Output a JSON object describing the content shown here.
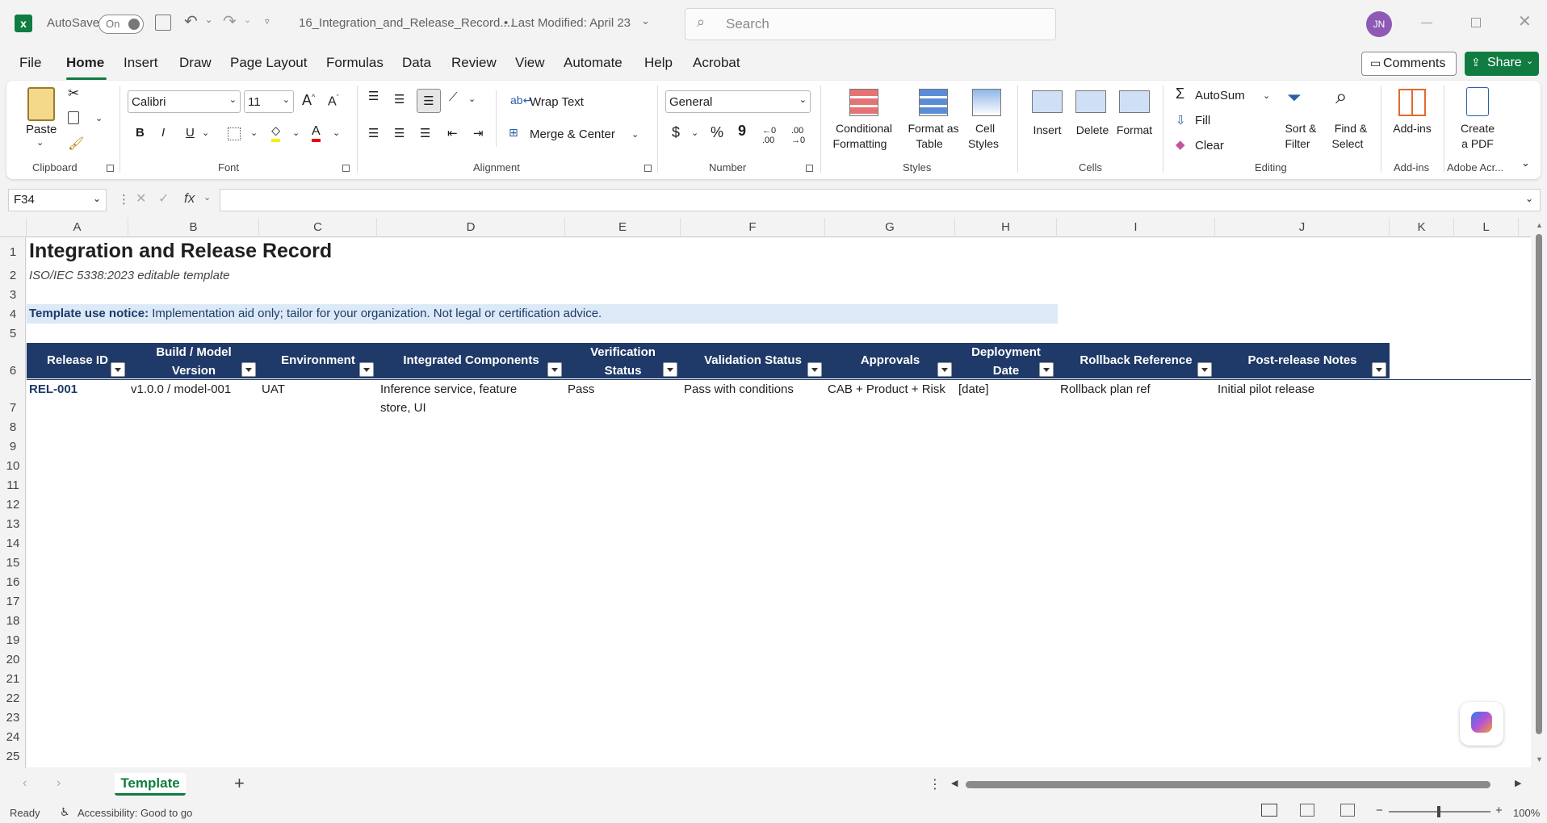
{
  "titlebar": {
    "autosave_label": "AutoSave",
    "autosave_state": "On",
    "filename": "16_Integration_and_Release_Record....",
    "modified": "• Last Modified: April 23",
    "search_placeholder": "Search",
    "avatar_initials": "JN"
  },
  "menu": [
    "File",
    "Home",
    "Insert",
    "Draw",
    "Page Layout",
    "Formulas",
    "Data",
    "Review",
    "View",
    "Automate",
    "Help",
    "Acrobat"
  ],
  "comments_label": "Comments",
  "share_label": "Share",
  "ribbon": {
    "paste": "Paste",
    "clipboard": "Clipboard",
    "font_name": "Calibri",
    "font_size": "11",
    "font": "Font",
    "wrap_text": "Wrap Text",
    "merge_center": "Merge & Center",
    "alignment": "Alignment",
    "number_format": "General",
    "number": "Number",
    "conditional_1": "Conditional",
    "conditional_2": "Formatting",
    "format_table_1": "Format as",
    "format_table_2": "Table",
    "cell_styles_1": "Cell",
    "cell_styles_2": "Styles",
    "styles": "Styles",
    "insert": "Insert",
    "delete": "Delete",
    "format": "Format",
    "cells": "Cells",
    "autosum": "AutoSum",
    "fill": "Fill",
    "clear": "Clear",
    "sort_1": "Sort &",
    "sort_2": "Filter",
    "find_1": "Find &",
    "find_2": "Select",
    "editing": "Editing",
    "addins": "Add-ins",
    "addins_group": "Add-ins",
    "pdf_1": "Create",
    "pdf_2": "a PDF",
    "adobe_group": "Adobe Acr..."
  },
  "formula_bar": {
    "name_box": "F34",
    "formula": ""
  },
  "columns": [
    "A",
    "B",
    "C",
    "D",
    "E",
    "F",
    "G",
    "H",
    "I",
    "J",
    "K",
    "L"
  ],
  "rows": [
    "1",
    "2",
    "3",
    "4",
    "5",
    "6",
    "7",
    "8",
    "9",
    "10",
    "11",
    "12",
    "13",
    "14",
    "15",
    "16",
    "17",
    "18",
    "19",
    "20",
    "21",
    "22",
    "23",
    "24",
    "25"
  ],
  "sheet": {
    "title": "Integration and Release Record",
    "subtitle": "ISO/IEC 5338:2023 editable template",
    "notice_label": "Template use notice:",
    "notice_text": " Implementation aid only; tailor for your organization. Not legal or certification advice.",
    "headers": [
      [
        "Release ID",
        ""
      ],
      [
        "Build / Model",
        "Version"
      ],
      [
        "Environment",
        ""
      ],
      [
        "Integrated Components",
        ""
      ],
      [
        "Verification",
        "Status"
      ],
      [
        "Validation Status",
        ""
      ],
      [
        "Approvals",
        ""
      ],
      [
        "Deployment",
        "Date"
      ],
      [
        "Rollback Reference",
        ""
      ],
      [
        "Post-release Notes",
        ""
      ]
    ],
    "row7": {
      "release_id": "REL-001",
      "build": "v1.0.0 / model-001",
      "environment": "UAT",
      "components_1": "Inference service, feature",
      "components_2": "store, UI",
      "verification": "Pass",
      "validation": "Pass with conditions",
      "approvals": "CAB + Product + Risk",
      "deployment": "[date]",
      "rollback": "Rollback plan ref",
      "notes": "Initial pilot release"
    }
  },
  "tabs": {
    "active": "Template"
  },
  "status": {
    "ready": "Ready",
    "accessibility": "Accessibility: Good to go",
    "zoom": "100%"
  },
  "colors": {
    "accent": "#107c41",
    "table_header": "#1f3a68",
    "notice_bg": "#dce9f7",
    "notice_label": "#1f3a68"
  }
}
